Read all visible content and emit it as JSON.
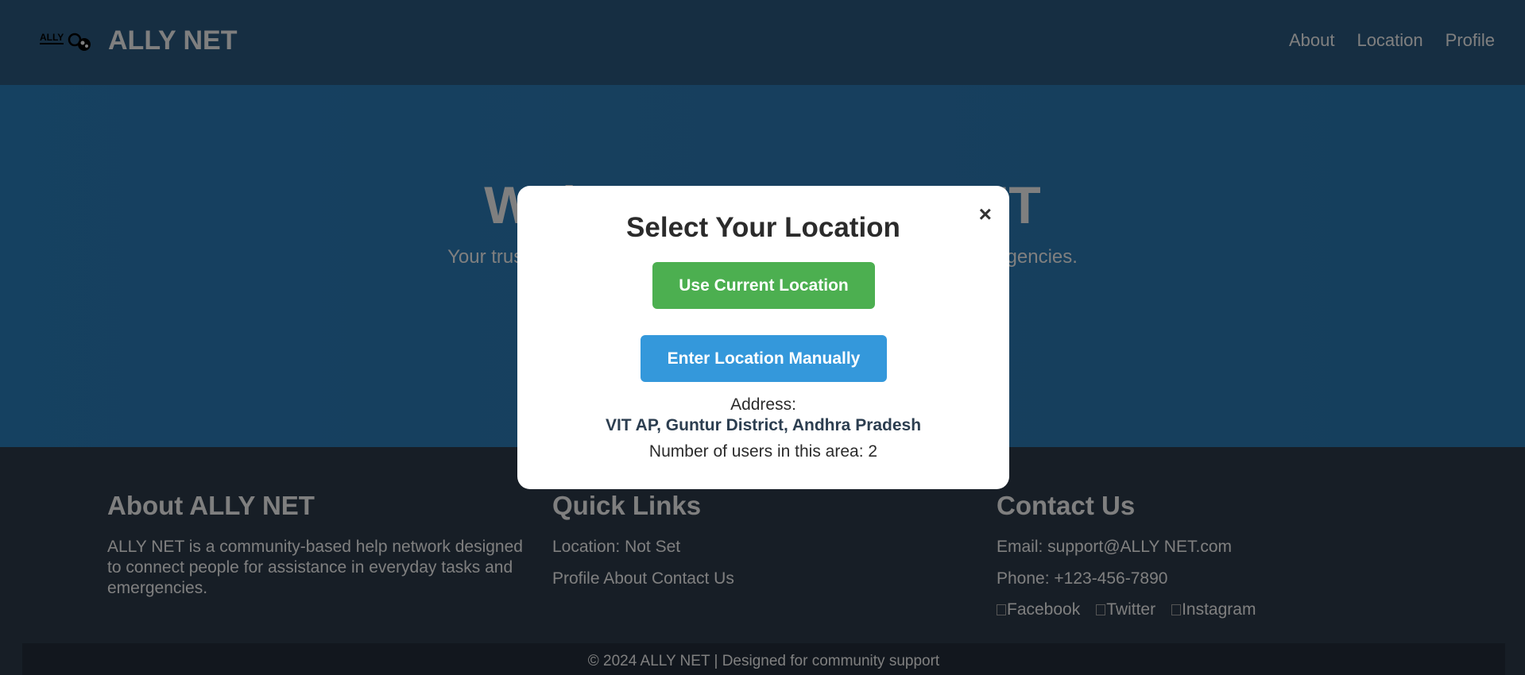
{
  "navbar": {
    "brand": "ALLY NET",
    "logo_text": "ALLY",
    "links": [
      "About",
      "Location",
      "Profile"
    ]
  },
  "hero": {
    "title": "Welcome to ALLY NET",
    "subtitle": "Your trusted community help network for everyday tasks and emergencies."
  },
  "footer": {
    "about": {
      "heading": "About ALLY NET",
      "text": "ALLY NET is a community-based help network designed to connect people for assistance in everyday tasks and emergencies."
    },
    "quick_links": {
      "heading": "Quick Links",
      "location": "Location: Not Set",
      "links": [
        "Profile",
        "About",
        "Contact Us"
      ]
    },
    "contact": {
      "heading": "Contact Us",
      "email": "Email: support@ALLY NET.com",
      "phone": "Phone: +123-456-7890",
      "social": [
        "Facebook",
        "Twitter",
        "Instagram"
      ]
    },
    "copyright": "© 2024 ALLY NET | Designed for community support"
  },
  "modal": {
    "title": "Select Your Location",
    "close_label": "×",
    "use_current_label": "Use Current Location",
    "enter_manual_label": "Enter Location Manually",
    "address_label": "Address:",
    "address_value": "VIT AP, Guntur District, Andhra Pradesh",
    "users_text": "Number of users in this area: 2"
  },
  "colors": {
    "nav_bg": "#2c5d84",
    "hero_bg": "#2f7fbc",
    "footer_bg": "#2f3c4c",
    "green_button": "#4caf50",
    "blue_button": "#3498db"
  }
}
